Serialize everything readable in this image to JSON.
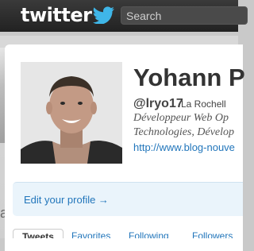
{
  "header": {
    "logo_text": "twitter",
    "search_placeholder": "Search"
  },
  "profile": {
    "name": "Yohann P",
    "handle": "@lryo17",
    "location": "La Rochell",
    "bio_line1": "Développeur Web Op",
    "bio_line2": "Technologies, Dévelop",
    "url": "http://www.blog-nouve"
  },
  "edit_profile_label": "Edit your profile →",
  "tabs": [
    "Tweets",
    "Favorites",
    "Following",
    "Followers"
  ],
  "background_fragment": "a",
  "colors": {
    "link": "#2276bb",
    "topbar": "#2a2a2a",
    "edit_box": "#eaf4fb"
  }
}
